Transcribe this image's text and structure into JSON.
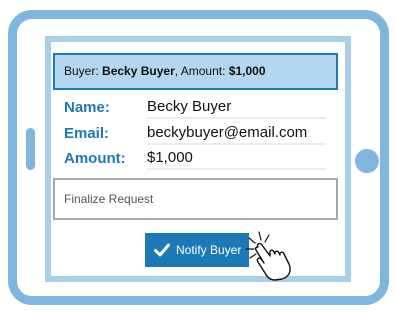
{
  "summary": {
    "buyer_prefix": "Buyer:",
    "buyer_name": "Becky Buyer",
    "amount_prefix": ", Amount:",
    "amount_value": "$1,000"
  },
  "form": {
    "name_label": "Name:",
    "name_value": "Becky Buyer",
    "email_label": "Email:",
    "email_value": "beckybuyer@email.com",
    "amount_label": "Amount:",
    "amount_value": "$1,000"
  },
  "finalize": {
    "label": "Finalize Request"
  },
  "notify_button": {
    "label": "Notify Buyer",
    "icon": "checkmark-icon"
  },
  "cursor": {
    "icon": "hand-pointer-click-icon"
  },
  "colors": {
    "accent": "#1c79b5",
    "tablet_frame": "#7fb6dd",
    "summary_bg": "#b2d7ef",
    "screen_border": "#a9cfe9"
  }
}
